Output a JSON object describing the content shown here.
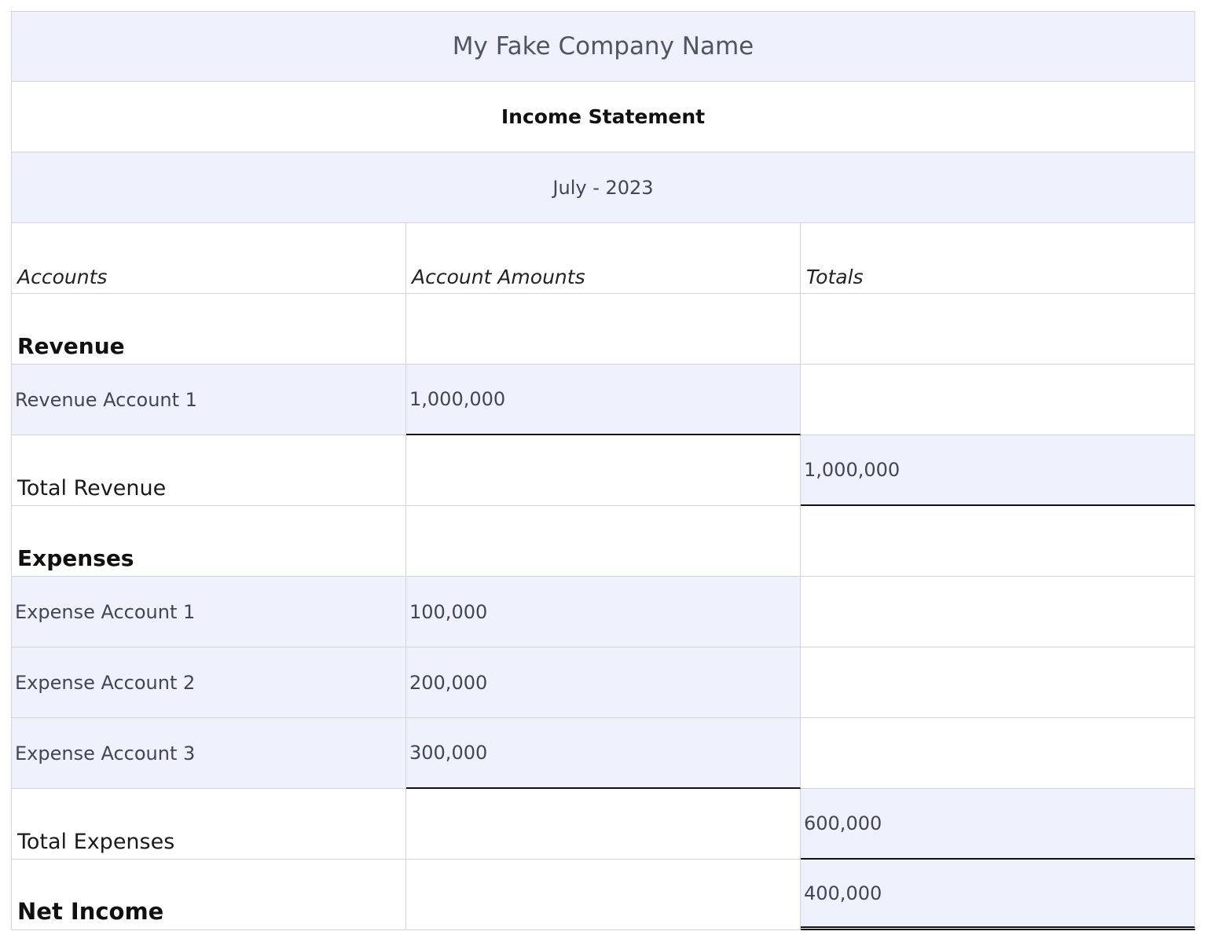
{
  "company_name": "My Fake Company Name",
  "statement_title": "Income Statement",
  "period": "July - 2023",
  "columns": {
    "accounts": "Accounts",
    "amounts": "Account Amounts",
    "totals": "Totals"
  },
  "revenue": {
    "section_label": "Revenue",
    "accounts": [
      {
        "name": "Revenue Account 1",
        "amount": "1,000,000"
      }
    ],
    "total_label": "Total Revenue",
    "total_value": "1,000,000"
  },
  "expenses": {
    "section_label": "Expenses",
    "accounts": [
      {
        "name": "Expense Account 1",
        "amount": "100,000"
      },
      {
        "name": "Expense Account 2",
        "amount": "200,000"
      },
      {
        "name": "Expense Account 3",
        "amount": "300,000"
      }
    ],
    "total_label": "Total Expenses",
    "total_value": "600,000"
  },
  "net_income": {
    "label": "Net Income",
    "value": "400,000"
  },
  "colors": {
    "row_tint": "#eff2fd",
    "grid": "#d4d4d4"
  }
}
